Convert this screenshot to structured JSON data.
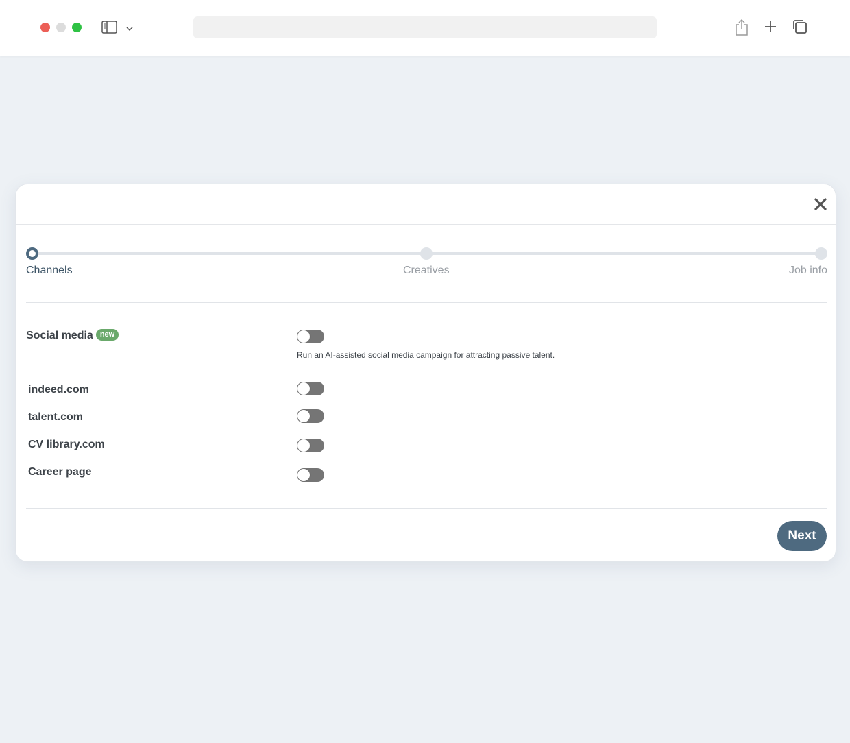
{
  "stepper": {
    "steps": [
      {
        "label": "Channels",
        "state": "active"
      },
      {
        "label": "Creatives",
        "state": "upcoming"
      },
      {
        "label": "Job info",
        "state": "upcoming"
      }
    ]
  },
  "channels": {
    "social_media": {
      "label": "Social media",
      "badge": "new",
      "enabled": false,
      "description": "Run an AI-assisted social media campaign for attracting passive talent."
    },
    "items": [
      {
        "label": "indeed.com",
        "enabled": false
      },
      {
        "label": "talent.com",
        "enabled": false
      },
      {
        "label": "CV library.com",
        "enabled": false
      },
      {
        "label": "Career page",
        "enabled": false
      }
    ]
  },
  "footer": {
    "next_label": "Next"
  },
  "colors": {
    "accent": "#4e6a80",
    "badge": "#6aa96b",
    "toggle_off": "#757575"
  }
}
